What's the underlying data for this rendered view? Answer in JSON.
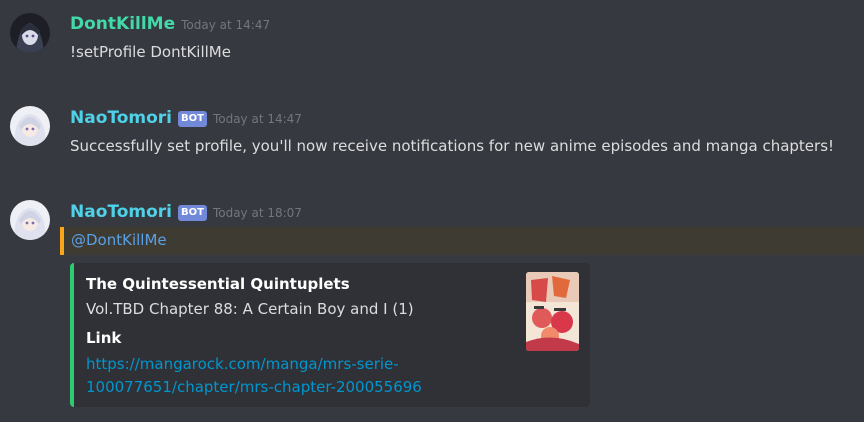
{
  "messages": [
    {
      "username": "DontKillMe",
      "timestamp": "Today at 14:47",
      "content": "!setProfile DontKillMe",
      "username_color": "#43d9a8",
      "avatar": "dark-anime-avatar-icon"
    },
    {
      "username": "NaoTomori",
      "bot_tag": "BOT",
      "timestamp": "Today at 14:47",
      "content": "Successfully set profile, you'll now receive notifications for new anime episodes and manga chapters!",
      "username_color": "#4fd1e8",
      "avatar": "white-hair-anime-avatar-icon"
    },
    {
      "username": "NaoTomori",
      "bot_tag": "BOT",
      "timestamp": "Today at 18:07",
      "mention": "@DontKillMe",
      "username_color": "#4fd1e8",
      "avatar": "white-hair-anime-avatar-icon",
      "embed": {
        "title": "The Quintessential Quintuplets",
        "description": "Vol.TBD Chapter 88: A Certain Boy and I (1)",
        "field_name": "Link",
        "field_value_line1": "https://mangarock.com/manga/mrs-serie-",
        "field_value_line2": "100077651/chapter/mrs-chapter-200055696",
        "border_color": "#2ecc71",
        "thumbnail": "manga-cover-thumbnail"
      }
    }
  ],
  "colors": {
    "background": "#36393f",
    "mention_highlight": "#faa61a",
    "link": "#0096cf"
  }
}
